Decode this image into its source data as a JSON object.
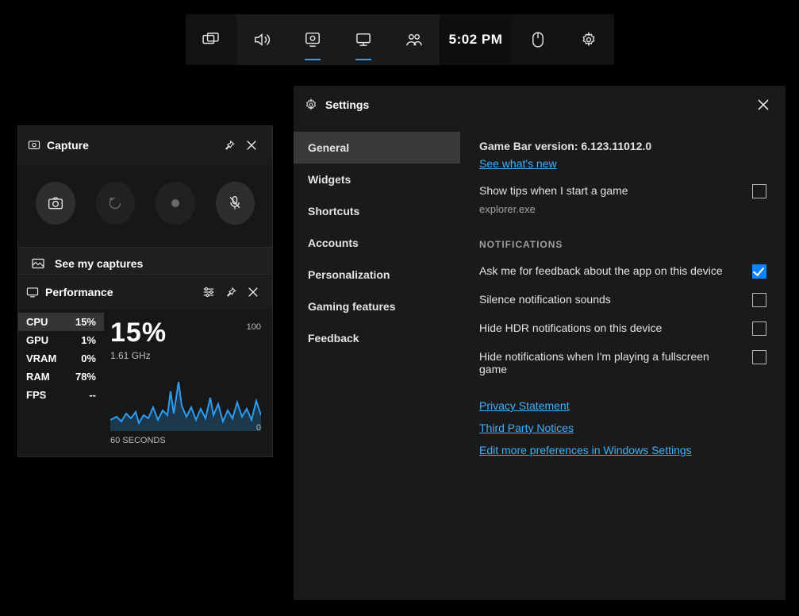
{
  "toolbar": {
    "time": "5:02 PM"
  },
  "capture": {
    "title": "Capture",
    "see_my_captures": "See my captures"
  },
  "performance": {
    "title": "Performance",
    "big_percent": "15%",
    "frequency": "1.61 GHz",
    "axis_top": "100",
    "axis_bottom": "0",
    "x_label": "60 SECONDS",
    "stats": [
      {
        "label": "CPU",
        "value": "15%"
      },
      {
        "label": "GPU",
        "value": "1%"
      },
      {
        "label": "VRAM",
        "value": "0%"
      },
      {
        "label": "RAM",
        "value": "78%"
      },
      {
        "label": "FPS",
        "value": "--"
      }
    ]
  },
  "settings": {
    "title": "Settings",
    "nav": {
      "general": "General",
      "widgets": "Widgets",
      "shortcuts": "Shortcuts",
      "accounts": "Accounts",
      "personalization": "Personalization",
      "gaming_features": "Gaming features",
      "feedback": "Feedback"
    },
    "content": {
      "version": "Game Bar version: 6.123.11012.0",
      "whats_new": "See what's new",
      "tips_label": "Show tips when I start a game",
      "process_name": "explorer.exe",
      "notifications_heading": "NOTIFICATIONS",
      "feedback_label": "Ask me for feedback about the app on this device",
      "silence_label": "Silence notification sounds",
      "hide_hdr_label": "Hide HDR notifications on this device",
      "hide_fullscreen_label": "Hide notifications when I'm playing a fullscreen game",
      "privacy_link": "Privacy Statement",
      "third_party_link": "Third Party Notices",
      "edit_prefs_link": "Edit more preferences in Windows Settings"
    }
  }
}
